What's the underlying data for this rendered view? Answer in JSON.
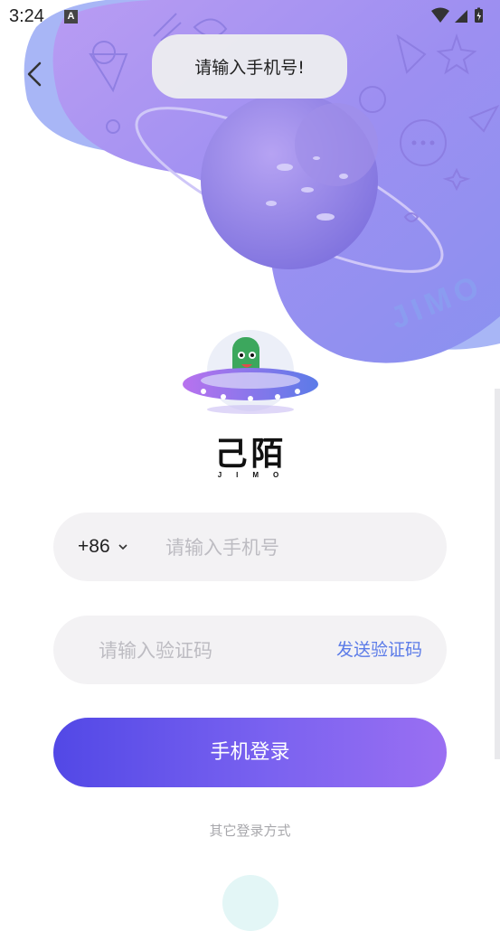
{
  "status_bar": {
    "time": "3:24",
    "notification_icon": "a-notification-icon",
    "right_icons": [
      "wifi-icon",
      "cell-signal-icon",
      "battery-charging-icon"
    ]
  },
  "hero": {
    "watermark": "JIMO",
    "colors": {
      "blob_light": "#a8b6f6",
      "blob_main": "#9c8ef0",
      "planet": "#8f7fe6"
    }
  },
  "toast": {
    "message": "请输入手机号!"
  },
  "logo": {
    "title": "己陌",
    "subtitle": "JIMO"
  },
  "phone": {
    "country_code": "+86",
    "placeholder": "请输入手机号"
  },
  "code": {
    "placeholder": "请输入验证码",
    "send_label": "发送验证码"
  },
  "login": {
    "label": "手机登录"
  },
  "other": {
    "label": "其它登录方式"
  },
  "colors": {
    "accent": "#5b7be8",
    "button_start": "#5248e6",
    "button_end": "#9a6ff2"
  }
}
